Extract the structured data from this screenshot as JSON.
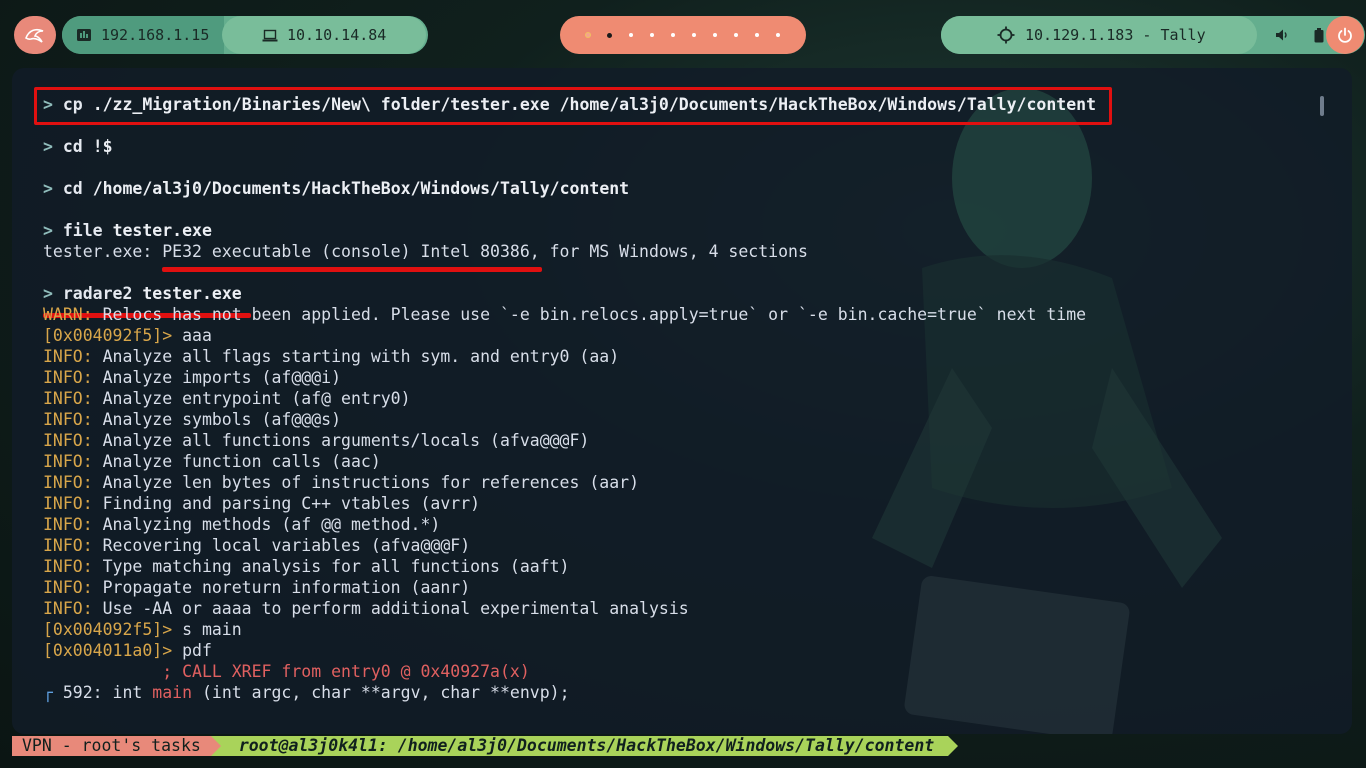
{
  "topbar": {
    "local_ip": "192.168.1.15",
    "vpn_ip": "10.10.14.84",
    "target": "10.129.1.183 - Tally",
    "workspaces": 10,
    "active_workspace": 2
  },
  "terminal": {
    "lines": [
      {
        "type": "prompt",
        "cmd": "cp",
        "args": "./zz_Migration/Binaries/New\\ folder/tester.exe /home/al3j0/Documents/HackTheBox/Windows/Tally/content"
      },
      {
        "type": "gap"
      },
      {
        "type": "prompt",
        "cmd": "cd",
        "args": "!$"
      },
      {
        "type": "gap"
      },
      {
        "type": "prompt",
        "cmd": "cd",
        "args": "/home/al3j0/Documents/HackTheBox/Windows/Tally/content"
      },
      {
        "type": "gap"
      },
      {
        "type": "prompt",
        "cmd": "file",
        "args": "tester.exe"
      },
      {
        "type": "plain",
        "text": "tester.exe: PE32 executable (console) Intel 80386, for MS Windows, 4 sections"
      },
      {
        "type": "gap"
      },
      {
        "type": "prompt",
        "cmd": "radare2",
        "args": "tester.exe"
      },
      {
        "type": "warn",
        "label": "WARN:",
        "text": " Relocs has not been applied. Please use `-e bin.relocs.apply=true` or `-e bin.cache=true` next time"
      },
      {
        "type": "r2",
        "addr": "[0x004092f5]>",
        "text": " aaa"
      },
      {
        "type": "info",
        "label": "INFO:",
        "text": " Analyze all flags starting with sym. and entry0 (aa)"
      },
      {
        "type": "info",
        "label": "INFO:",
        "text": " Analyze imports (af@@@i)"
      },
      {
        "type": "info",
        "label": "INFO:",
        "text": " Analyze entrypoint (af@ entry0)"
      },
      {
        "type": "info",
        "label": "INFO:",
        "text": " Analyze symbols (af@@@s)"
      },
      {
        "type": "info",
        "label": "INFO:",
        "text": " Analyze all functions arguments/locals (afva@@@F)"
      },
      {
        "type": "info",
        "label": "INFO:",
        "text": " Analyze function calls (aac)"
      },
      {
        "type": "info",
        "label": "INFO:",
        "text": " Analyze len bytes of instructions for references (aar)"
      },
      {
        "type": "info",
        "label": "INFO:",
        "text": " Finding and parsing C++ vtables (avrr)"
      },
      {
        "type": "info",
        "label": "INFO:",
        "text": " Analyzing methods (af @@ method.*)"
      },
      {
        "type": "info",
        "label": "INFO:",
        "text": " Recovering local variables (afva@@@F)"
      },
      {
        "type": "info",
        "label": "INFO:",
        "text": " Type matching analysis for all functions (aaft)"
      },
      {
        "type": "info",
        "label": "INFO:",
        "text": " Propagate noreturn information (aanr)"
      },
      {
        "type": "info",
        "label": "INFO:",
        "text": " Use -AA or aaaa to perform additional experimental analysis"
      },
      {
        "type": "r2",
        "addr": "[0x004092f5]>",
        "text": " s main"
      },
      {
        "type": "r2",
        "addr": "[0x004011a0]>",
        "text": " pdf"
      },
      {
        "type": "xref",
        "text": "            ; CALL XREF from entry0 @ 0x40927a(x)"
      },
      {
        "type": "func",
        "corner": "┌",
        "pre": " 592: int ",
        "name": "main",
        "post": " (int argc, char **argv, char **envp);"
      }
    ]
  },
  "statusbar": {
    "left": "VPN - root's tasks",
    "right": "root@al3j0k4l1: /home/al3j0/Documents/HackTheBox/Windows/Tally/content"
  },
  "icons": {
    "kali": "kali-dragon-icon",
    "local": "network-icon",
    "vpn": "laptop-icon",
    "target": "crosshair-icon",
    "volume": "volume-icon",
    "battery": "battery-icon",
    "power": "power-icon"
  }
}
